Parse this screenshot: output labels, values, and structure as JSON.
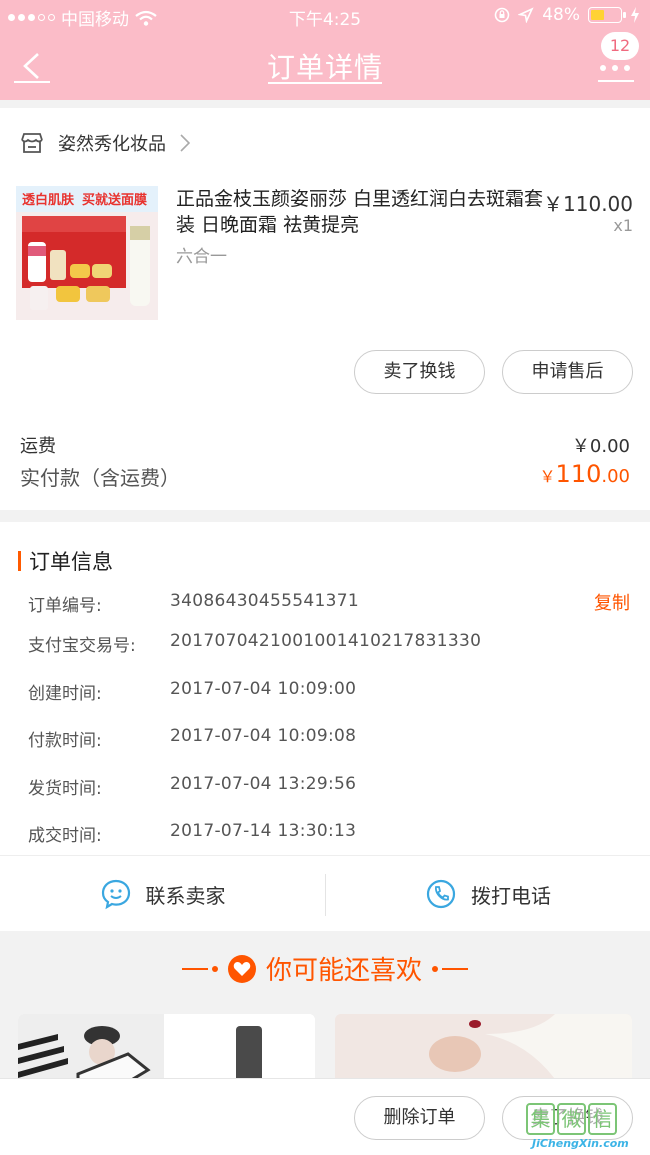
{
  "status_bar": {
    "carrier": "中国移动",
    "time": "下午4:25",
    "battery": "48%",
    "battery_level": 0.48
  },
  "nav": {
    "title": "订单详情",
    "badge_count": "12"
  },
  "shop": {
    "name": "姿然秀化妆品"
  },
  "product": {
    "title": "正品金枝玉颜姿丽莎 白里透红润白去斑霜套装 日晚面霜 祛黄提亮",
    "variant": "六合一",
    "price": "￥110.00",
    "quantity": "x1",
    "image_banner_left": "透白肌肤",
    "image_banner_right": "买就送面膜"
  },
  "actions": {
    "sell_label": "卖了换钱",
    "after_sale_label": "申请售后"
  },
  "fees": {
    "shipping_label": "运费",
    "shipping_value": "￥0.00",
    "paid_label": "实付款（含运费）",
    "paid_symbol": "￥",
    "paid_integer": "110",
    "paid_decimal": ".00"
  },
  "order_info": {
    "heading": "订单信息",
    "copy_label": "复制",
    "rows": [
      {
        "key": "订单编号:",
        "value": "34086430455541371"
      },
      {
        "key": "支付宝交易号:",
        "value": "2017070421001001410217831330"
      },
      {
        "key": "创建时间:",
        "value": "2017-07-04 10:09:00"
      },
      {
        "key": "付款时间:",
        "value": "2017-07-04 10:09:08"
      },
      {
        "key": "发货时间:",
        "value": "2017-07-04 13:29:56"
      },
      {
        "key": "成交时间:",
        "value": "2017-07-14 13:30:13"
      }
    ]
  },
  "contact": {
    "seller_label": "联系卖家",
    "phone_label": "拨打电话"
  },
  "recommend": {
    "title": "你可能还喜欢"
  },
  "bottom": {
    "delete_label": "删除订单",
    "sell_label": "卖了换钱"
  },
  "watermark": {
    "chars": [
      "集",
      "微",
      "信"
    ],
    "url": "JiChengXin.com"
  },
  "colors": {
    "header_pink": "#fbbcc8",
    "accent_orange": "#ff5500",
    "contact_blue": "#3aa7e0"
  }
}
